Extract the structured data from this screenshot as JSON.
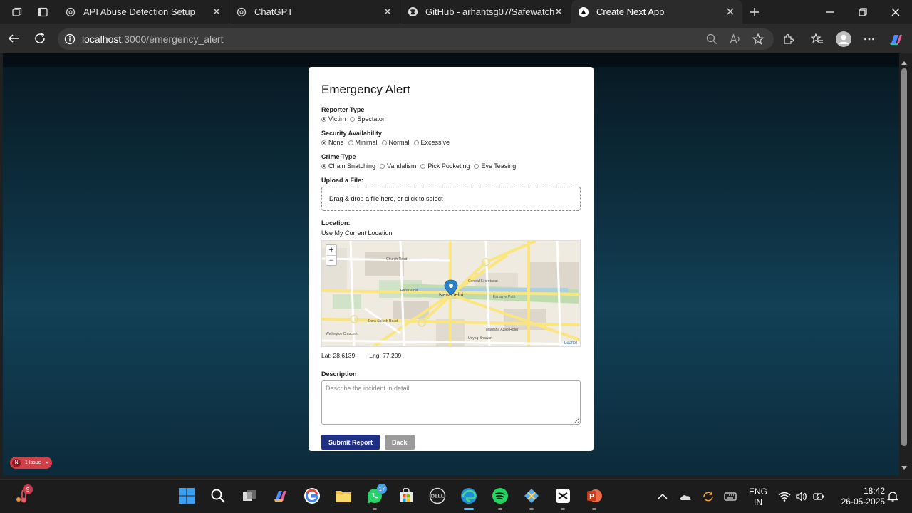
{
  "browser": {
    "tabs": [
      {
        "title": "API Abuse Detection Setup",
        "active": false
      },
      {
        "title": "ChatGPT",
        "active": false
      },
      {
        "title": "GitHub - arhantsg07/Safewatch",
        "active": false
      },
      {
        "title": "Create Next App",
        "active": true
      }
    ],
    "url_host": "localhost",
    "url_path": ":3000/emergency_alert"
  },
  "form": {
    "title": "Emergency Alert",
    "reporter_type": {
      "label": "Reporter Type",
      "options": [
        "Victim",
        "Spectator"
      ],
      "selected": "Victim"
    },
    "security": {
      "label": "Security Availability",
      "options": [
        "None",
        "Minimal",
        "Normal",
        "Excessive"
      ],
      "selected": "None"
    },
    "crime_type": {
      "label": "Crime Type",
      "options": [
        "Chain Snatching",
        "Vandalism",
        "Pick Pocketing",
        "Eve Teasing"
      ],
      "selected": "Chain Snatching"
    },
    "upload": {
      "label": "Upload a File:",
      "dropzone_text": "Drag & drop a file here, or click to select"
    },
    "location": {
      "label": "Location:",
      "use_current": "Use My Current Location",
      "map": {
        "center_label": "New Delhi",
        "zoom_in": "+",
        "zoom_out": "−",
        "attribution": "Leaflet",
        "streets": [
          "Church Road",
          "Raisina Hill",
          "Dara Shikoh Road",
          "Maulana Azad Road",
          "Kartavya Path",
          "Central Secretariat",
          "Udyog Bhawan",
          "Wellington Crescent"
        ]
      },
      "lat": "Lat: 28.6139",
      "lng": "Lng: 77.209"
    },
    "description": {
      "label": "Description",
      "placeholder": "Describe the incident in detail"
    },
    "submit_label": "Submit Report",
    "back_label": "Back"
  },
  "dev_overlay": {
    "letter": "N",
    "text": "1 Issue",
    "close": "×"
  },
  "taskbar": {
    "weather_badge": "9",
    "whatsapp_badge": "17",
    "language": "ENG",
    "region": "IN",
    "time": "18:42",
    "date": "26-05-2025"
  },
  "colors": {
    "primary_button": "#1f2f86",
    "secondary_button": "#9a9a9a",
    "issue_badge": "#d33f49"
  }
}
